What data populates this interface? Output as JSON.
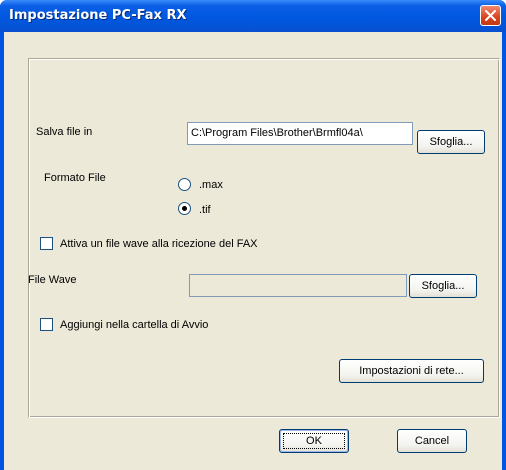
{
  "window": {
    "title": "Impostazione PC-Fax RX",
    "close_icon": "close-icon"
  },
  "save": {
    "label": "Salva file in",
    "path_value": "C:\\Program Files\\Brother\\Brmfl04a\\",
    "browse_label": "Sfoglia..."
  },
  "format": {
    "label": "Formato File",
    "options": [
      {
        "label": ".max",
        "selected": false
      },
      {
        "label": ".tif",
        "selected": true
      }
    ]
  },
  "wave": {
    "checkbox_label": "Attiva un file wave alla ricezione del FAX",
    "checked": false,
    "field_label": "File Wave",
    "field_value": "",
    "browse_label": "Sfoglia..."
  },
  "startup": {
    "checkbox_label": "Aggiungi nella cartella di Avvio",
    "checked": false
  },
  "network_button_label": "Impostazioni di rete...",
  "footer": {
    "ok_label": "OK",
    "cancel_label": "Cancel"
  }
}
